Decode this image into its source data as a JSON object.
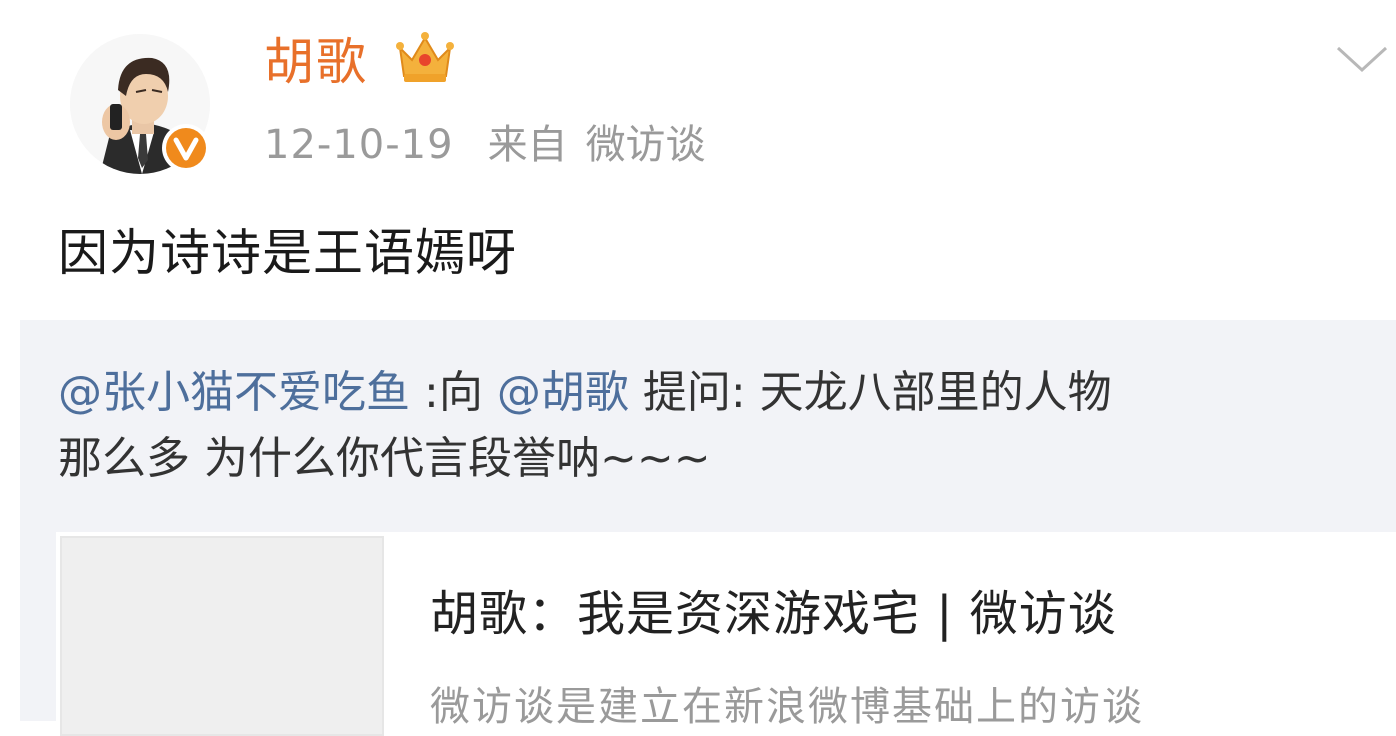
{
  "post": {
    "username": "胡歌",
    "date": "12-10-19",
    "from_label": "来自",
    "source": "微访谈",
    "text": "因为诗诗是王语嫣呀"
  },
  "quote": {
    "mention_user": "@张小猫不爱吃鱼",
    "colon_to": ":向",
    "mention_target": "@胡歌",
    "ask_label": "提问:",
    "line1_rest": "天龙八部里的人物",
    "line2": "那么多 为什么你代言段誉呐~~~"
  },
  "card": {
    "title": "胡歌：我是资深游戏宅 | 微访谈",
    "description": "微访谈是建立在新浪微博基础上的访谈"
  },
  "colors": {
    "username": "#e8702a",
    "mention": "#4e6f9c",
    "meta": "#9a9a9a",
    "quote_bg": "#f2f3f7",
    "verified": "#f08a1c"
  },
  "icons": {
    "avatar": "user-avatar",
    "verified": "verified-badge-icon",
    "crown": "crown-icon",
    "menu": "chevron-down-icon"
  }
}
